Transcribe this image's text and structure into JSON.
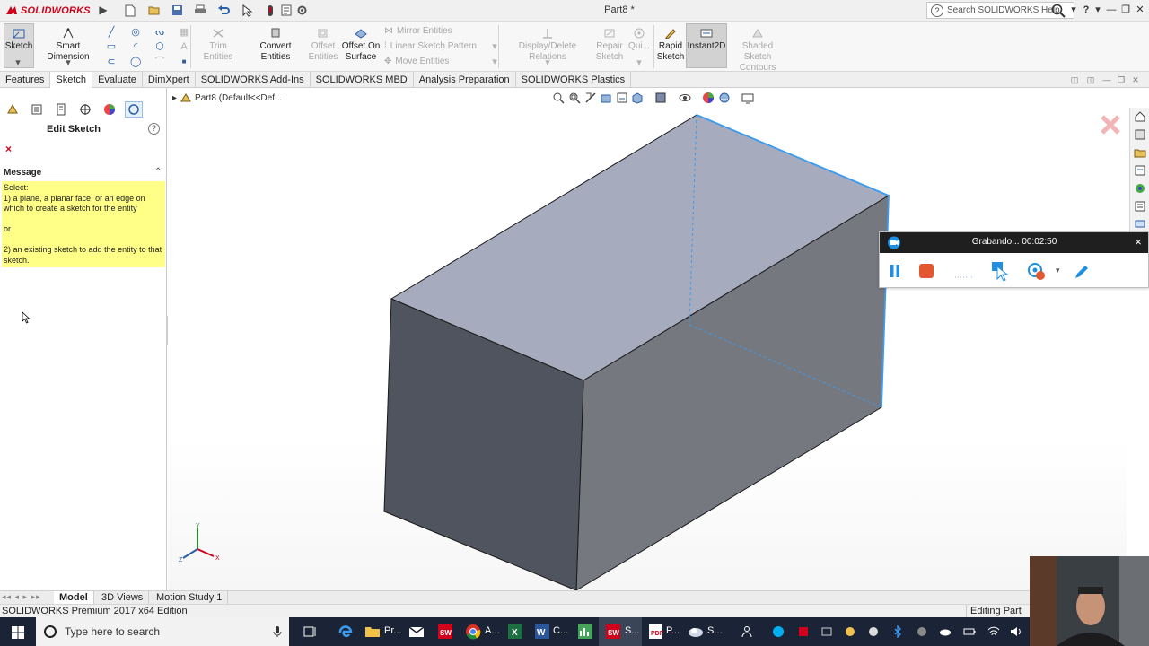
{
  "app": {
    "logo_text": "SOLIDWORKS",
    "doc_title": "Part8 *",
    "search_placeholder": "Search SOLIDWORKS Help",
    "help_glyph": "?"
  },
  "toolbar": {
    "sketch": "Sketch",
    "smart_dimension": "Smart Dimension",
    "trim_entities": "Trim Entities",
    "convert_entities": "Convert Entities",
    "offset_entities_1": "Offset",
    "offset_entities_2": "Entities",
    "offset_on_surface_1": "Offset On",
    "offset_on_surface_2": "Surface",
    "mirror_entities": "Mirror Entities",
    "linear_sketch_pattern": "Linear Sketch Pattern",
    "move_entities": "Move Entities",
    "display_delete_relations": "Display/Delete Relations",
    "repair_sketch_1": "Repair",
    "repair_sketch_2": "Sketch",
    "quick_snaps": "Qui...",
    "rapid_sketch_1": "Rapid",
    "rapid_sketch_2": "Sketch",
    "instant2d": "Instant2D",
    "shaded_contours_1": "Shaded Sketch",
    "shaded_contours_2": "Contours"
  },
  "tabs": [
    "Features",
    "Sketch",
    "Evaluate",
    "DimXpert",
    "SOLIDWORKS Add-Ins",
    "SOLIDWORKS MBD",
    "Analysis Preparation",
    "SOLIDWORKS Plastics"
  ],
  "active_tab": "Sketch",
  "panel": {
    "title": "Edit Sketch",
    "close_glyph": "×",
    "message_header": "Message",
    "message_lines": [
      "Select:",
      "1) a plane, a planar face, or an edge on which to create a sketch for the entity",
      "",
      "or",
      "",
      "2) an existing sketch to add the entity to that sketch."
    ]
  },
  "tree": {
    "root_label": "Part8  (Default<<Def..."
  },
  "recording": {
    "title": "Grabando... 00:02:50",
    "close_glyph": "×"
  },
  "bottom_tabs": [
    "Model",
    "3D Views",
    "Motion Study 1"
  ],
  "status": {
    "left": "SOLIDWORKS Premium 2017 x64 Edition",
    "right": "Editing Part"
  },
  "taskbar": {
    "search_placeholder": "Type here to search",
    "labels": [
      "Pr...",
      "A...",
      "C...",
      "S...",
      "P...",
      "S..."
    ]
  },
  "colors": {
    "box_top": "#a6abbd",
    "box_front": "#50545e",
    "box_right": "#75787f",
    "selected_edge": "#3b9bf0",
    "message_bg": "#ffff88",
    "brand_red": "#d0021b"
  }
}
